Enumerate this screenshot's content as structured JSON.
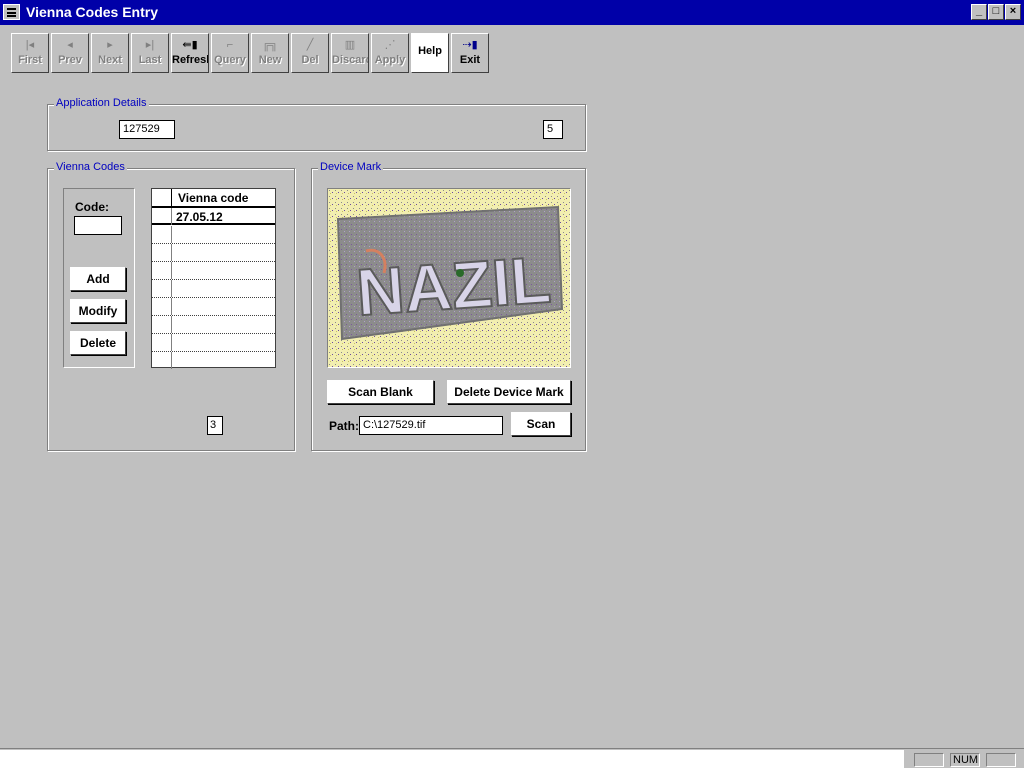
{
  "window": {
    "title": "Vienna Codes Entry"
  },
  "toolbar": {
    "buttons": [
      {
        "label": "First",
        "icon": "first-record-icon",
        "enabled": false
      },
      {
        "label": "Prev",
        "icon": "previous-record-icon",
        "enabled": false
      },
      {
        "label": "Next",
        "icon": "next-record-icon",
        "enabled": false
      },
      {
        "label": "Last",
        "icon": "last-record-icon",
        "enabled": false
      },
      {
        "label": "Refresh",
        "icon": "refresh-icon",
        "enabled": true
      },
      {
        "label": "Query",
        "icon": "query-icon",
        "enabled": false
      },
      {
        "label": "New",
        "icon": "new-record-icon",
        "enabled": false
      },
      {
        "label": "Del",
        "icon": "delete-record-icon",
        "enabled": false
      },
      {
        "label": "Discard",
        "icon": "discard-icon",
        "enabled": false
      },
      {
        "label": "Apply",
        "icon": "apply-icon",
        "enabled": false
      },
      {
        "label": "Help",
        "icon": "",
        "enabled": true
      },
      {
        "label": "Exit",
        "icon": "exit-door-icon",
        "enabled": true
      }
    ]
  },
  "application_details": {
    "legend": "Application Details",
    "application_number": "127529",
    "count": "5"
  },
  "vienna_codes": {
    "legend": "Vienna Codes",
    "code_label": "Code:",
    "code_value": "",
    "add_label": "Add",
    "modify_label": "Modify",
    "delete_label": "Delete",
    "grid_header": "Vienna code",
    "rows": [
      "27.05.12",
      "",
      "",
      "",
      "",
      "",
      "",
      "",
      ""
    ],
    "total": "3"
  },
  "device_mark": {
    "legend": "Device Mark",
    "image_text": "NAZIL",
    "scan_blank_label": "Scan Blank",
    "delete_mark_label": "Delete Device Mark",
    "path_label": "Path:",
    "path_value": "C:\\127529.tif",
    "scan_label": "Scan"
  },
  "statusbar": {
    "panels": [
      "",
      "NUM",
      ""
    ]
  },
  "colors": {
    "titlebar": "#0000a8",
    "legend_text": "#0000c0",
    "face": "#c0c0c0"
  }
}
